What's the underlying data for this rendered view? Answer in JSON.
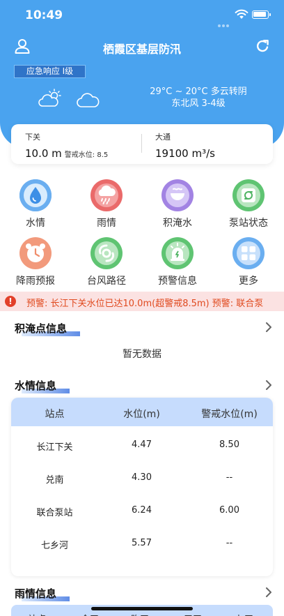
{
  "status_bar": {
    "time": "10:49"
  },
  "header": {
    "title": "栖霞区基层防汛",
    "badge": "应急响应 I级",
    "weather": {
      "temp_line": "29°C ~ 20°C 多云转阴",
      "wind_line": "东北风 3-4级"
    },
    "background_color": "#4aa3ef"
  },
  "hydro": [
    {
      "name": "下关",
      "value": "10.0 m",
      "warning": "警戒水位: 8.5"
    },
    {
      "name": "大通",
      "value": "19100 m³/s"
    }
  ],
  "menu": [
    {
      "label": "水情",
      "icon": "water-drop-icon",
      "color": "#5aa2ec"
    },
    {
      "label": "雨情",
      "icon": "rain-cloud-icon",
      "color": "#e85e5e"
    },
    {
      "label": "积淹水",
      "icon": "ponding-bowl-icon",
      "color": "#9b7be0"
    },
    {
      "label": "泵站状态",
      "icon": "pump-icon",
      "color": "#58c26c"
    },
    {
      "label": "降雨预报",
      "icon": "alarm-clock-icon",
      "color": "#f08e6d"
    },
    {
      "label": "台风路径",
      "icon": "typhoon-icon",
      "color": "#58c26c"
    },
    {
      "label": "预警信息",
      "icon": "warning-light-icon",
      "color": "#58c26c"
    },
    {
      "label": "更多",
      "icon": "more-grid-icon",
      "color": "#5aa2ec"
    }
  ],
  "ticker": {
    "text": "预警: 长江下关水位已达10.0m(超警戒8.5m)  预警: 联合泵"
  },
  "ponding": {
    "title": "积淹点信息",
    "empty_text": "暂无数据"
  },
  "water": {
    "title": "水情信息",
    "columns": [
      "站点",
      "水位(m)",
      "警戒水位(m)"
    ],
    "rows": [
      [
        "长江下关",
        "4.47",
        "8.50"
      ],
      [
        "兑南",
        "4.30",
        "--"
      ],
      [
        "联合泵站",
        "6.24",
        "6.00"
      ],
      [
        "七乡河",
        "5.57",
        "--"
      ]
    ]
  },
  "rain": {
    "title": "雨情信息",
    "columns": [
      "站点",
      "今天",
      "昨天",
      "三天",
      "七天"
    ]
  }
}
